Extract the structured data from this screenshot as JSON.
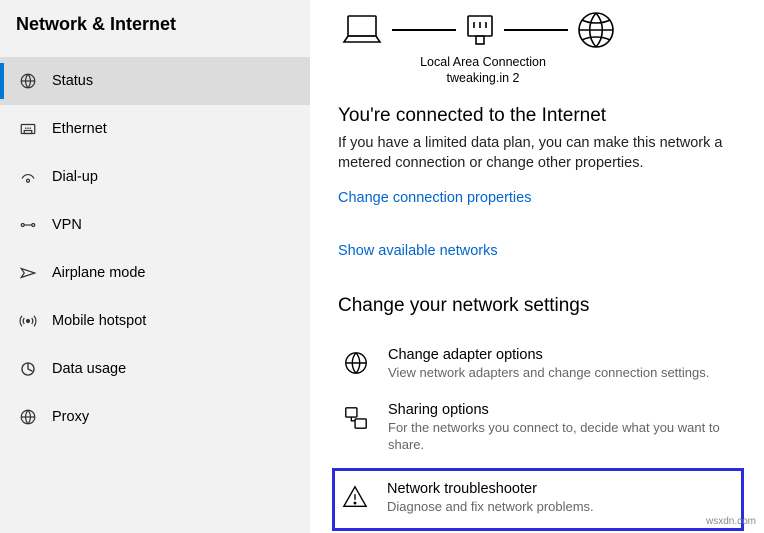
{
  "sidebar": {
    "title": "Network & Internet",
    "items": [
      {
        "label": "Status",
        "icon": "status-icon",
        "selected": true
      },
      {
        "label": "Ethernet",
        "icon": "ethernet-icon",
        "selected": false
      },
      {
        "label": "Dial-up",
        "icon": "dialup-icon",
        "selected": false
      },
      {
        "label": "VPN",
        "icon": "vpn-icon",
        "selected": false
      },
      {
        "label": "Airplane mode",
        "icon": "airplane-icon",
        "selected": false
      },
      {
        "label": "Mobile hotspot",
        "icon": "hotspot-icon",
        "selected": false
      },
      {
        "label": "Data usage",
        "icon": "datausage-icon",
        "selected": false
      },
      {
        "label": "Proxy",
        "icon": "proxy-icon",
        "selected": false
      }
    ]
  },
  "diagram": {
    "caption_line1": "Local Area Connection",
    "caption_line2": "tweaking.in 2"
  },
  "status": {
    "heading": "You're connected to the Internet",
    "desc": "If you have a limited data plan, you can make this network a metered connection or change other properties.",
    "link_properties": "Change connection properties",
    "link_networks": "Show available networks"
  },
  "settings": {
    "heading": "Change your network settings",
    "rows": [
      {
        "title": "Change adapter options",
        "desc": "View network adapters and change connection settings.",
        "icon": "adapter-icon",
        "highlighted": false
      },
      {
        "title": "Sharing options",
        "desc": "For the networks you connect to, decide what you want to share.",
        "icon": "sharing-icon",
        "highlighted": false
      },
      {
        "title": "Network troubleshooter",
        "desc": "Diagnose and fix network problems.",
        "icon": "troubleshoot-icon",
        "highlighted": true
      }
    ]
  },
  "watermark": "wsxdn.com"
}
